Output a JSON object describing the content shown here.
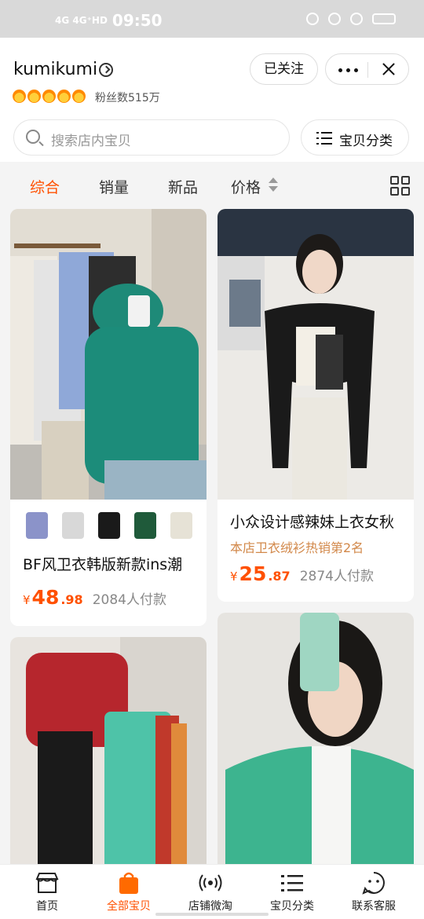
{
  "status_bar": {
    "network": "4G 4G⁺HD",
    "time": "09:50"
  },
  "shop": {
    "name": "kumikumi",
    "fans": "粉丝数515万",
    "follow_label": "已关注",
    "search_placeholder": "搜索店内宝贝",
    "category_label": "宝贝分类"
  },
  "sort_tabs": [
    {
      "label": "综合",
      "active": true
    },
    {
      "label": "销量",
      "active": false
    },
    {
      "label": "新品",
      "active": false
    },
    {
      "label": "价格",
      "active": false
    }
  ],
  "products": [
    {
      "title": "BF风卫衣韩版新款ins潮",
      "currency": "¥",
      "price_int": "48",
      "price_dec": ".98",
      "sales": "2084人付款",
      "swatch_colors": [
        "#8b93c9",
        "#d8d8d8",
        "#1a1a1a",
        "#1f5a3a",
        "#e6e2d6"
      ]
    },
    {
      "title": "小众设计感辣妹上衣女秋",
      "promo": "本店卫衣绒衫热销第2名",
      "currency": "¥",
      "price_int": "25",
      "price_dec": ".87",
      "sales": "2874人付款"
    }
  ],
  "bottom_nav": [
    {
      "label": "首页",
      "icon": "store-icon",
      "active": false
    },
    {
      "label": "全部宝贝",
      "icon": "shopping-bag-icon",
      "active": true
    },
    {
      "label": "店铺微淘",
      "icon": "broadcast-icon",
      "active": false
    },
    {
      "label": "宝贝分类",
      "icon": "list-icon",
      "active": false
    },
    {
      "label": "联系客服",
      "icon": "chat-icon",
      "active": false
    }
  ],
  "colors": {
    "accent": "#ff5000",
    "promo": "#d2884a"
  }
}
